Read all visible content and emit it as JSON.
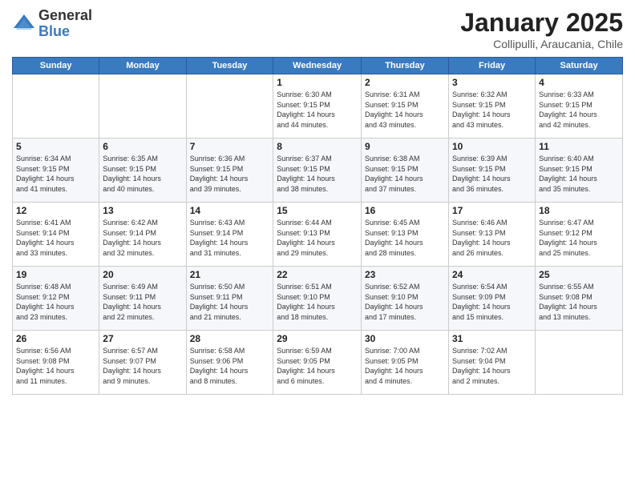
{
  "logo": {
    "general": "General",
    "blue": "Blue"
  },
  "header": {
    "month": "January 2025",
    "location": "Collipulli, Araucania, Chile"
  },
  "weekdays": [
    "Sunday",
    "Monday",
    "Tuesday",
    "Wednesday",
    "Thursday",
    "Friday",
    "Saturday"
  ],
  "weeks": [
    [
      {
        "day": "",
        "info": ""
      },
      {
        "day": "",
        "info": ""
      },
      {
        "day": "",
        "info": ""
      },
      {
        "day": "1",
        "info": "Sunrise: 6:30 AM\nSunset: 9:15 PM\nDaylight: 14 hours\nand 44 minutes."
      },
      {
        "day": "2",
        "info": "Sunrise: 6:31 AM\nSunset: 9:15 PM\nDaylight: 14 hours\nand 43 minutes."
      },
      {
        "day": "3",
        "info": "Sunrise: 6:32 AM\nSunset: 9:15 PM\nDaylight: 14 hours\nand 43 minutes."
      },
      {
        "day": "4",
        "info": "Sunrise: 6:33 AM\nSunset: 9:15 PM\nDaylight: 14 hours\nand 42 minutes."
      }
    ],
    [
      {
        "day": "5",
        "info": "Sunrise: 6:34 AM\nSunset: 9:15 PM\nDaylight: 14 hours\nand 41 minutes."
      },
      {
        "day": "6",
        "info": "Sunrise: 6:35 AM\nSunset: 9:15 PM\nDaylight: 14 hours\nand 40 minutes."
      },
      {
        "day": "7",
        "info": "Sunrise: 6:36 AM\nSunset: 9:15 PM\nDaylight: 14 hours\nand 39 minutes."
      },
      {
        "day": "8",
        "info": "Sunrise: 6:37 AM\nSunset: 9:15 PM\nDaylight: 14 hours\nand 38 minutes."
      },
      {
        "day": "9",
        "info": "Sunrise: 6:38 AM\nSunset: 9:15 PM\nDaylight: 14 hours\nand 37 minutes."
      },
      {
        "day": "10",
        "info": "Sunrise: 6:39 AM\nSunset: 9:15 PM\nDaylight: 14 hours\nand 36 minutes."
      },
      {
        "day": "11",
        "info": "Sunrise: 6:40 AM\nSunset: 9:15 PM\nDaylight: 14 hours\nand 35 minutes."
      }
    ],
    [
      {
        "day": "12",
        "info": "Sunrise: 6:41 AM\nSunset: 9:14 PM\nDaylight: 14 hours\nand 33 minutes."
      },
      {
        "day": "13",
        "info": "Sunrise: 6:42 AM\nSunset: 9:14 PM\nDaylight: 14 hours\nand 32 minutes."
      },
      {
        "day": "14",
        "info": "Sunrise: 6:43 AM\nSunset: 9:14 PM\nDaylight: 14 hours\nand 31 minutes."
      },
      {
        "day": "15",
        "info": "Sunrise: 6:44 AM\nSunset: 9:13 PM\nDaylight: 14 hours\nand 29 minutes."
      },
      {
        "day": "16",
        "info": "Sunrise: 6:45 AM\nSunset: 9:13 PM\nDaylight: 14 hours\nand 28 minutes."
      },
      {
        "day": "17",
        "info": "Sunrise: 6:46 AM\nSunset: 9:13 PM\nDaylight: 14 hours\nand 26 minutes."
      },
      {
        "day": "18",
        "info": "Sunrise: 6:47 AM\nSunset: 9:12 PM\nDaylight: 14 hours\nand 25 minutes."
      }
    ],
    [
      {
        "day": "19",
        "info": "Sunrise: 6:48 AM\nSunset: 9:12 PM\nDaylight: 14 hours\nand 23 minutes."
      },
      {
        "day": "20",
        "info": "Sunrise: 6:49 AM\nSunset: 9:11 PM\nDaylight: 14 hours\nand 22 minutes."
      },
      {
        "day": "21",
        "info": "Sunrise: 6:50 AM\nSunset: 9:11 PM\nDaylight: 14 hours\nand 21 minutes."
      },
      {
        "day": "22",
        "info": "Sunrise: 6:51 AM\nSunset: 9:10 PM\nDaylight: 14 hours\nand 18 minutes."
      },
      {
        "day": "23",
        "info": "Sunrise: 6:52 AM\nSunset: 9:10 PM\nDaylight: 14 hours\nand 17 minutes."
      },
      {
        "day": "24",
        "info": "Sunrise: 6:54 AM\nSunset: 9:09 PM\nDaylight: 14 hours\nand 15 minutes."
      },
      {
        "day": "25",
        "info": "Sunrise: 6:55 AM\nSunset: 9:08 PM\nDaylight: 14 hours\nand 13 minutes."
      }
    ],
    [
      {
        "day": "26",
        "info": "Sunrise: 6:56 AM\nSunset: 9:08 PM\nDaylight: 14 hours\nand 11 minutes."
      },
      {
        "day": "27",
        "info": "Sunrise: 6:57 AM\nSunset: 9:07 PM\nDaylight: 14 hours\nand 9 minutes."
      },
      {
        "day": "28",
        "info": "Sunrise: 6:58 AM\nSunset: 9:06 PM\nDaylight: 14 hours\nand 8 minutes."
      },
      {
        "day": "29",
        "info": "Sunrise: 6:59 AM\nSunset: 9:05 PM\nDaylight: 14 hours\nand 6 minutes."
      },
      {
        "day": "30",
        "info": "Sunrise: 7:00 AM\nSunset: 9:05 PM\nDaylight: 14 hours\nand 4 minutes."
      },
      {
        "day": "31",
        "info": "Sunrise: 7:02 AM\nSunset: 9:04 PM\nDaylight: 14 hours\nand 2 minutes."
      },
      {
        "day": "",
        "info": ""
      }
    ]
  ]
}
